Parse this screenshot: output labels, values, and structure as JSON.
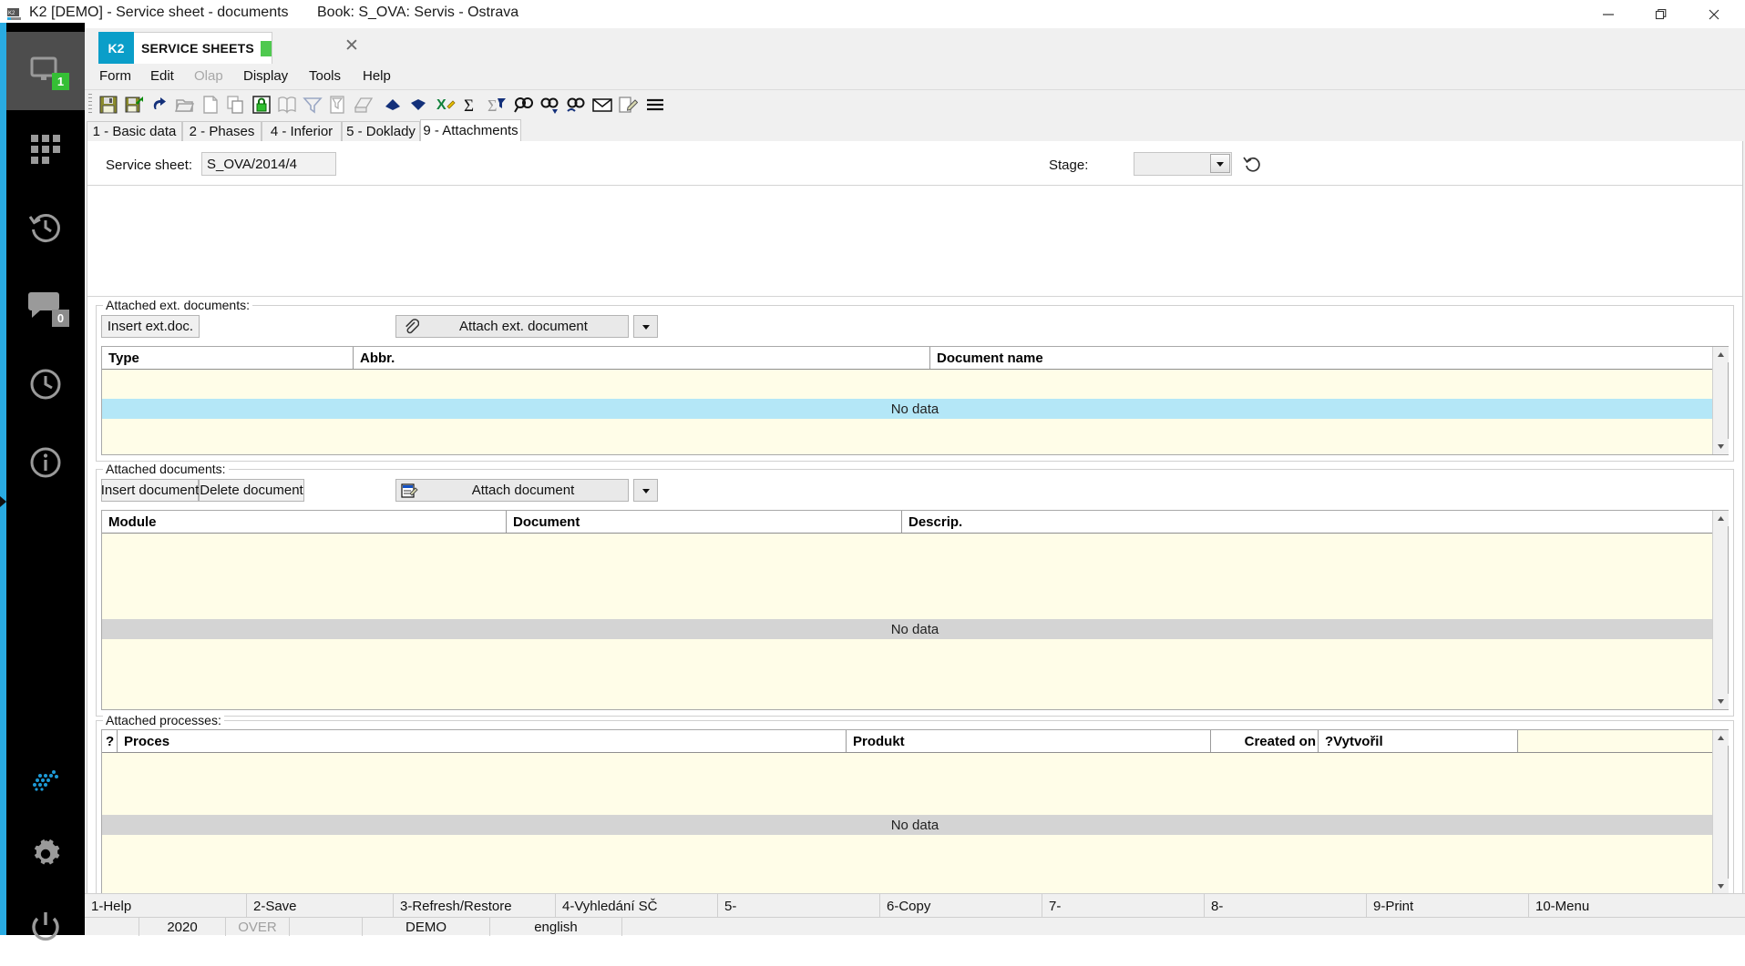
{
  "window": {
    "title": "K2 [DEMO] - Service sheet - documents",
    "book": "Book: S_OVA: Servis - Ostrava",
    "minimize_label": "—",
    "maximize_label": "❐",
    "close_label": "✕"
  },
  "sidebar": {
    "items": [
      {
        "name": "monitor",
        "badge": "1"
      },
      {
        "name": "apps-grid",
        "badge": ""
      },
      {
        "name": "history",
        "badge": ""
      },
      {
        "name": "messages",
        "badge": "0"
      },
      {
        "name": "clock",
        "badge": ""
      },
      {
        "name": "info",
        "badge": ""
      },
      {
        "name": "sparkle",
        "badge": ""
      },
      {
        "name": "settings",
        "badge": ""
      },
      {
        "name": "power",
        "badge": ""
      }
    ]
  },
  "doctab": {
    "k2_label": "K2",
    "label": "SERVICE SHEETS",
    "close_label": "✕"
  },
  "menu": {
    "items": [
      {
        "label": "Form",
        "disabled": false
      },
      {
        "label": "Edit",
        "disabled": false
      },
      {
        "label": "Olap",
        "disabled": true
      },
      {
        "label": "Display",
        "disabled": false
      },
      {
        "label": "Tools",
        "disabled": false
      },
      {
        "label": "Help",
        "disabled": false
      }
    ]
  },
  "toolbar": {
    "icons": [
      "save-icon",
      "save-as-icon",
      "undo-icon",
      "open-folder-icon",
      "new-document-icon",
      "copy-icon",
      "lock-icon",
      "book-icon",
      "filter-icon",
      "list-filter-icon",
      "print-preview-icon",
      "move-up-icon",
      "move-down-icon",
      "excel-export-icon",
      "sum-icon",
      "sum-filter-icon",
      "find-icon",
      "find-next-icon",
      "find-replace-icon",
      "mail-icon",
      "edit-note-icon",
      "menu-icon"
    ]
  },
  "pagetabs": [
    {
      "label": "1 - Basic data",
      "active": false
    },
    {
      "label": "2 - Phases",
      "active": false
    },
    {
      "label": "4 - Inferior",
      "active": false
    },
    {
      "label": "5 - Doklady",
      "active": false
    },
    {
      "label": "9 - Attachments",
      "active": true
    }
  ],
  "header_fields": {
    "service_sheet_label": "Service sheet:",
    "service_sheet_value": "S_OVA/2014/4",
    "stage_label": "Stage:",
    "stage_value": "",
    "stage_history_icon": "history-revert-icon"
  },
  "ext_documents": {
    "caption": "Attached ext. documents:",
    "insert_button": "Insert ext.doc.",
    "attach_button": "Attach ext. document",
    "attach_icon": "paperclip-icon",
    "dropdown_icon": "chevron-down-icon",
    "columns": [
      "Type",
      "Abbr.",
      "Document name"
    ],
    "rows": [],
    "empty_text": "No data"
  },
  "documents": {
    "caption": "Attached documents:",
    "insert_button": "Insert document",
    "delete_button": "Delete document",
    "attach_button": "Attach document",
    "attach_icon": "document-attach-icon",
    "dropdown_icon": "chevron-down-icon",
    "columns": [
      "Module",
      "Document",
      "Descrip."
    ],
    "rows": [],
    "empty_text": "No data"
  },
  "processes": {
    "caption": "Attached processes:",
    "columns": [
      "?",
      "Proces",
      "Produkt",
      "Created on",
      "?Vytvořil"
    ],
    "rows": [],
    "empty_text": "No data"
  },
  "function_keys": [
    "1-Help",
    "2-Save",
    "3-Refresh/Restore",
    "4-Vyhledání SČ",
    "5-",
    "6-Copy",
    "7-",
    "8-",
    "9-Print",
    "10-Menu"
  ],
  "statusbar": {
    "year": "2020",
    "insert_mode": "OVER",
    "database": "DEMO",
    "language": "english"
  },
  "colors": {
    "accent": "#29abe2",
    "tab_accent": "#0a9ec9",
    "status_green": "#4fc94f",
    "grid_bg": "#fffde8",
    "selected_row": "#b4e7f7"
  }
}
